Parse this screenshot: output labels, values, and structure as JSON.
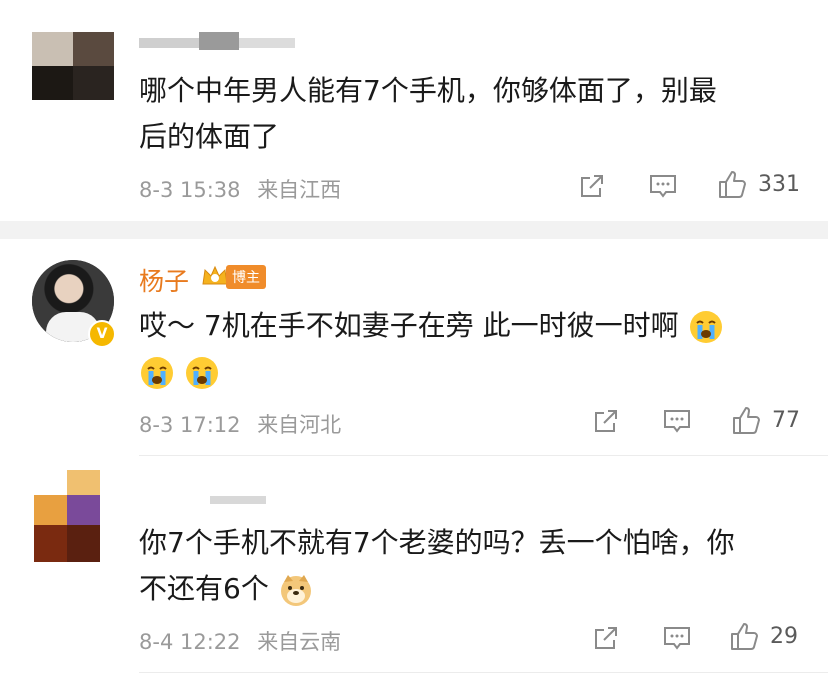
{
  "comments": [
    {
      "text_line1": "哪个中年男人能有7个手机，你够体面了，别最",
      "text_line2": "后的体面了",
      "date": "8-3 15:38",
      "location": "来自江西",
      "likes": "331"
    },
    {
      "username": "杨子",
      "badge": "博主",
      "text_line1": "哎～ 7机在手不如妻子在旁 此一时彼一时啊",
      "date": "8-3 17:12",
      "location": "来自河北",
      "likes": "77"
    },
    {
      "text_line1": "你7个手机不就有7个老婆的吗？丢一个怕啥，你",
      "text_line2": "不还有6个",
      "date": "8-4 12:22",
      "location": "来自云南",
      "likes": "29"
    }
  ],
  "icons": {
    "repost": "repost-icon",
    "comment": "comment-icon",
    "like": "thumbs-up-icon",
    "emoji_cry": "crying-emoji-icon",
    "emoji_doge": "doge-emoji-icon"
  },
  "colors": {
    "username": "#e87a1e",
    "badge": "#f08c2a",
    "meta": "#9a9a9a"
  }
}
